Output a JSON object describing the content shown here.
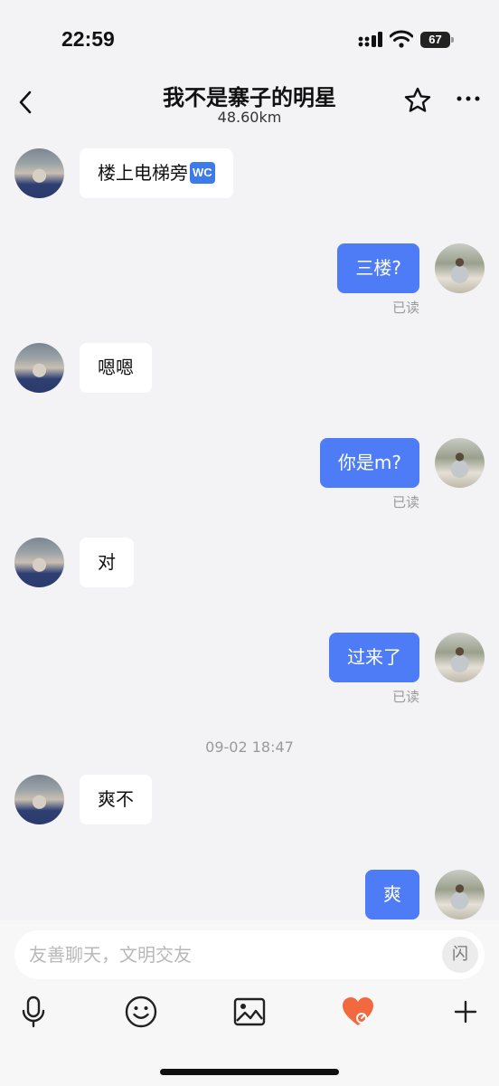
{
  "status_bar": {
    "time": "22:59",
    "battery": "67"
  },
  "header": {
    "title": "我不是寨子的明星",
    "distance": "48.60km"
  },
  "messages": [
    {
      "side": "left",
      "text": "楼上电梯旁",
      "emoji": "WC"
    },
    {
      "side": "right",
      "text": "三楼?",
      "read": "已读"
    },
    {
      "side": "left",
      "text": "嗯嗯"
    },
    {
      "side": "right",
      "text": "你是m?",
      "read": "已读"
    },
    {
      "side": "left",
      "text": "对"
    },
    {
      "side": "right",
      "text": "过来了",
      "read": "已读"
    },
    {
      "side": "left",
      "text": "爽不"
    },
    {
      "side": "right",
      "text": "爽"
    }
  ],
  "timestamp": "09-02 18:47",
  "input": {
    "placeholder": "友善聊天，文明交友",
    "flash_label": "闪"
  },
  "toolbar": {
    "icons": [
      "microphone-icon",
      "emoji-icon",
      "image-icon",
      "heart-icon",
      "plus-icon"
    ]
  },
  "colors": {
    "accent": "#4d7cf6",
    "heart": "#f2683f",
    "background": "#f3f3f5"
  }
}
